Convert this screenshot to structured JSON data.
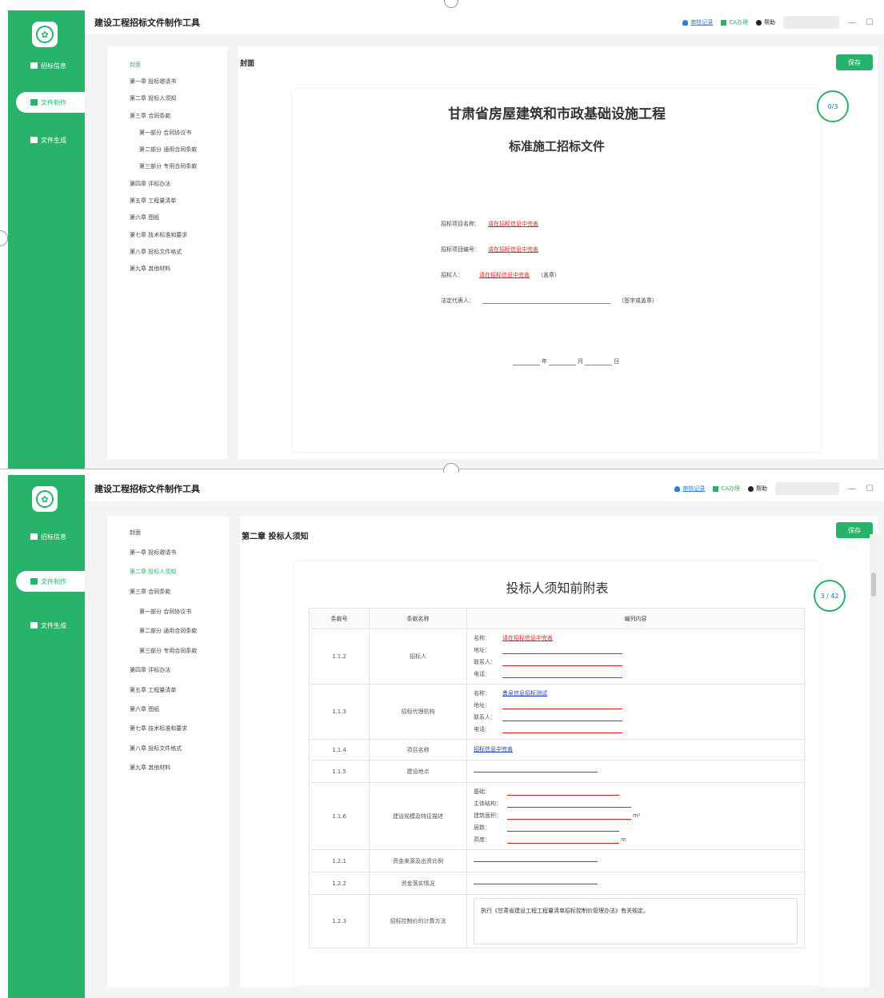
{
  "screen1": {
    "app_title": "建设工程招标文件制作工具",
    "toolbar": {
      "record_label": "审核记录",
      "ca_label": "CA办理",
      "help_label": "帮助"
    },
    "sidebar": [
      {
        "label": "招标信息"
      },
      {
        "label": "文件制作"
      },
      {
        "label": "文件生成"
      }
    ],
    "toc": [
      "封面",
      "第一章 投标邀请书",
      "第二章 投标人须知",
      "第三章 合同条款",
      "第一部分 合同协议书",
      "第二部分 通用合同条款",
      "第三部分 专用合同条款",
      "第四章 评标办法",
      "第五章 工程量清单",
      "第六章 图纸",
      "第七章 技术标准和要求",
      "第八章 投标文件格式",
      "第九章 其他材料"
    ],
    "main_title": "封面",
    "save_label": "保存",
    "progress": "0/3",
    "cover": {
      "title": "甘肃省房屋建筑和市政基础设施工程",
      "subtitle": "标准施工招标文件",
      "project_name_label": "招标项目名称：",
      "project_name_value": "请在招标信息中完善",
      "project_no_label": "招标项目编号：",
      "project_no_value": "请在招标信息中完善",
      "tenderer_label": "招标人：",
      "tenderer_value": "请在招标信息中完善",
      "tenderer_suffix": "（盖章）",
      "legal_rep_label": "法定代表人：",
      "legal_rep_suffix": "（签字或盖章）",
      "date_year": "年",
      "date_month": "月",
      "date_day": "日"
    }
  },
  "screen2": {
    "app_title": "建设工程招标文件制作工具",
    "toolbar": {
      "record_label": "审核记录",
      "ca_label": "CA办理",
      "help_label": "帮助"
    },
    "sidebar": [
      {
        "label": "招标信息"
      },
      {
        "label": "文件制作"
      },
      {
        "label": "文件生成"
      }
    ],
    "toc": [
      "封面",
      "第一章 投标邀请书",
      "第二章 投标人须知",
      "第三章 合同条款",
      "第一部分 合同协议书",
      "第二部分 通用合同条款",
      "第三部分 专用合同条款",
      "第四章 评标办法",
      "第五章 工程量清单",
      "第六章 图纸",
      "第七章 技术标准和要求",
      "第八章 投标文件格式",
      "第九章 其他材料"
    ],
    "main_title": "第二章 投标人须知",
    "save_label": "保存",
    "progress": "3 / 42",
    "doc_title": "投标人须知前附表",
    "table": {
      "headers": [
        "条款号",
        "条款名称",
        "编列内容"
      ],
      "rows": [
        {
          "no": "1.1.2",
          "name": "招标人",
          "lines": [
            "名称：",
            "地址：",
            "联系人：",
            "电话："
          ],
          "name_value": "请在招标信息中完善"
        },
        {
          "no": "1.1.3",
          "name": "招标代理机构",
          "lines": [
            "名称：",
            "地址：",
            "联系人：",
            "电话："
          ],
          "name_value": "勇泉信息招标测试"
        },
        {
          "no": "1.1.4",
          "name": "项目名称",
          "value": "招标信息中完善"
        },
        {
          "no": "1.1.5",
          "name": "建设地点"
        },
        {
          "no": "1.1.6",
          "name": "建设规模及特征描述",
          "lines": [
            "基础：",
            "主体结构：",
            "建筑面积：",
            "层数：",
            "高度："
          ],
          "area_unit": "m²",
          "height_unit": "m"
        },
        {
          "no": "1.2.1",
          "name": "资金来源及出资比例"
        },
        {
          "no": "1.2.2",
          "name": "资金落实情况"
        },
        {
          "no": "1.2.3",
          "name": "招标控制价的计算方法",
          "text": "执行《甘肃省建设工程工程量清单招标控制价管理办法》有关规定。"
        }
      ]
    }
  }
}
